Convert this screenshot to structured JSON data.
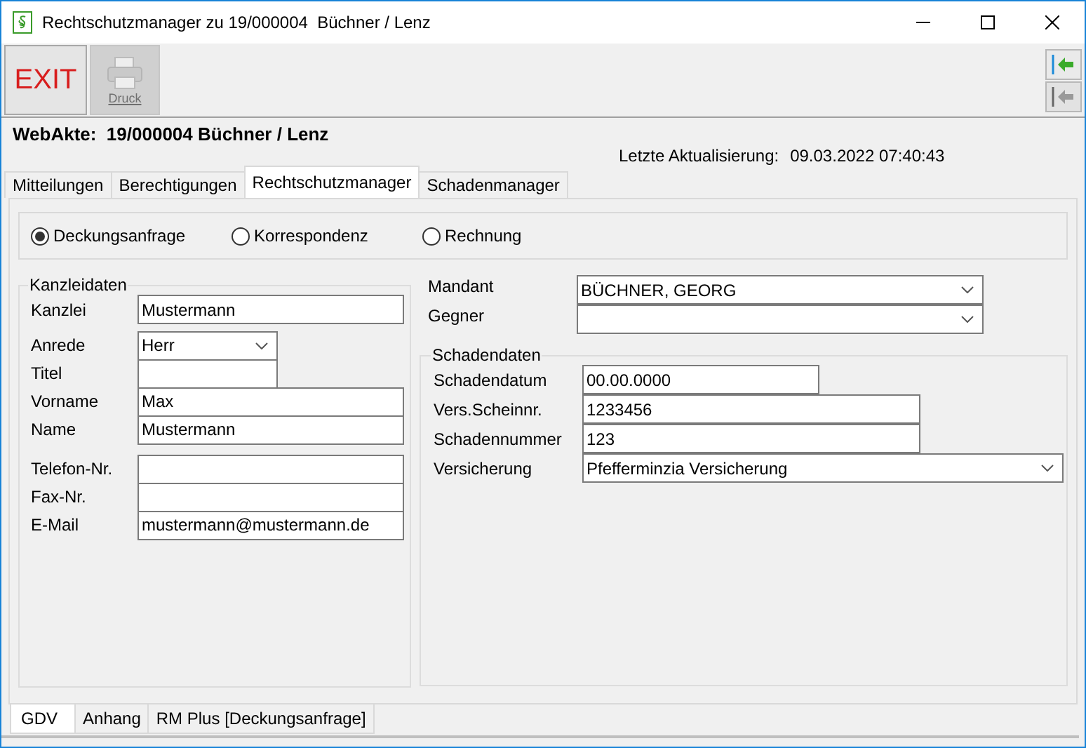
{
  "window": {
    "title": "Rechtschutzmanager zu 19/000004  Büchner / Lenz"
  },
  "toolbar": {
    "buttons": [
      {
        "kind": "exit",
        "label": "EXIT",
        "disabled": false
      },
      {
        "kind": "print",
        "label": "Druck",
        "disabled": true
      }
    ],
    "side_buttons": [
      {
        "disabled": false
      },
      {
        "disabled": true
      }
    ]
  },
  "header": {
    "title": "WebAkte:  19/000004 Büchner / Lenz",
    "last_update_label": "Letzte Aktualisierung:",
    "last_update_value": "09.03.2022 07:40:43"
  },
  "tabs": [
    {
      "label": "Mitteilungen",
      "selected": false
    },
    {
      "label": "Berechtigungen",
      "selected": false
    },
    {
      "label": "Rechtschutzmanager",
      "selected": true
    },
    {
      "label": "Schadenmanager",
      "selected": false
    }
  ],
  "radios": [
    {
      "label": "Deckungsanfrage",
      "selected": true
    },
    {
      "label": "Korrespondenz",
      "selected": false
    },
    {
      "label": "Rechnung",
      "selected": false
    }
  ],
  "kanzleidaten": {
    "title": "Kanzleidaten",
    "fields": [
      {
        "label": "Kanzlei",
        "kind": "text",
        "value": "Mustermann"
      },
      {
        "label": "Anrede",
        "kind": "select",
        "value": "Herr"
      },
      {
        "label": "Titel",
        "kind": "text"
      },
      {
        "label": "Vorname",
        "kind": "text",
        "value": "Max"
      },
      {
        "label": "Name",
        "kind": "text",
        "value": "Mustermann"
      },
      {
        "label": "Telefon-Nr.",
        "kind": "text"
      },
      {
        "label": "Fax-Nr.",
        "kind": "text"
      },
      {
        "label": "E-Mail",
        "kind": "text",
        "value": "mustermann@mustermann.de"
      }
    ]
  },
  "parties": [
    {
      "label": "Mandant",
      "kind": "select",
      "value": "BÜCHNER, GEORG"
    },
    {
      "label": "Gegner",
      "kind": "select"
    }
  ],
  "schadendaten": {
    "title": "Schadendaten",
    "fields": [
      {
        "label": "Schadendatum",
        "kind": "text",
        "value": "00.00.0000"
      },
      {
        "label": "Vers.Scheinnr.",
        "kind": "text",
        "value": "1233456"
      },
      {
        "label": "Schadennummer",
        "kind": "text",
        "value": "123"
      },
      {
        "label": "Versicherung",
        "kind": "select",
        "value": "Pfefferminzia Versicherung"
      }
    ]
  },
  "bottom_tabs": [
    {
      "label": "GDV",
      "selected": true
    },
    {
      "label": "Anhang",
      "selected": false
    },
    {
      "label": "RM Plus [Deckungsanfrage]",
      "selected": false
    }
  ]
}
